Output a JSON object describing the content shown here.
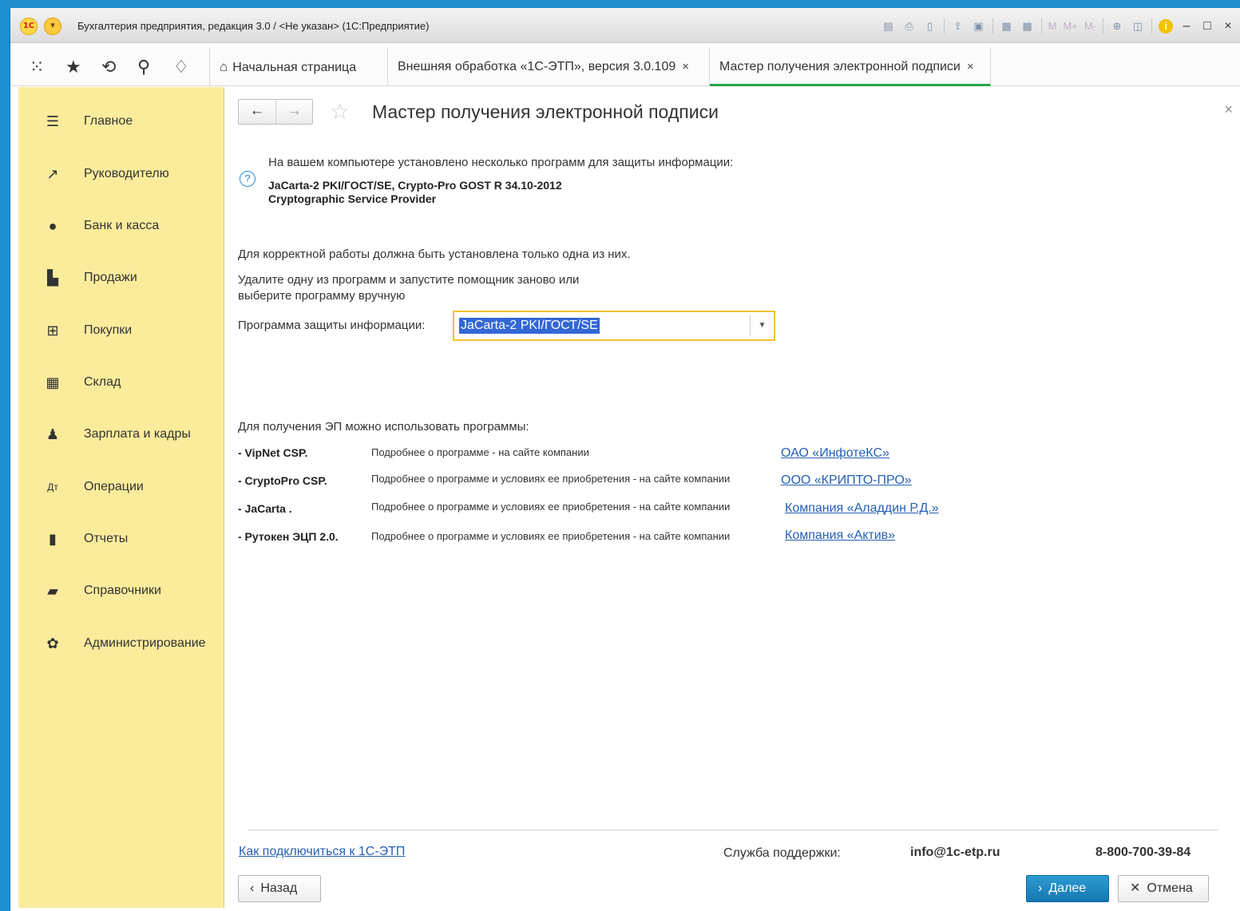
{
  "window": {
    "title": "Бухгалтерия предприятия, редакция 3.0 / <Не указан>  (1С:Предприятие)",
    "logo": "1С",
    "toolbar_icons": [
      "save-icon",
      "print-icon",
      "preview-icon",
      "attach-icon",
      "copy-icon",
      "calculator-icon",
      "calendar-icon"
    ],
    "memory_buttons": [
      "M",
      "M+",
      "M-"
    ]
  },
  "quick_icons": [
    "apps-grid-icon",
    "favorites-star-icon",
    "history-icon",
    "search-icon",
    "notifications-bell-icon"
  ],
  "tabs": [
    {
      "label": "Начальная страница"
    },
    {
      "label": "Внешняя обработка «1С-ЭТП», версия 3.0.109",
      "close": "×"
    },
    {
      "label": "Мастер получения электронной подписи",
      "close": "×"
    }
  ],
  "sidebar": {
    "items": [
      {
        "label": "Главное",
        "icon": "menu-lines-icon"
      },
      {
        "label": "Руководителю",
        "icon": "trend-chart-icon"
      },
      {
        "label": "Банк и касса",
        "icon": "ruble-coin-icon"
      },
      {
        "label": "Продажи",
        "icon": "shopping-bag-icon"
      },
      {
        "label": "Покупки",
        "icon": "cart-icon"
      },
      {
        "label": "Склад",
        "icon": "warehouse-grid-icon"
      },
      {
        "label": "Зарплата и кадры",
        "icon": "person-icon"
      },
      {
        "label": "Операции",
        "icon": "debit-credit-icon"
      },
      {
        "label": "Отчеты",
        "icon": "bar-chart-icon"
      },
      {
        "label": "Справочники",
        "icon": "books-icon"
      },
      {
        "label": "Администрирование",
        "icon": "gear-icon"
      }
    ]
  },
  "main": {
    "title": "Мастер получения электронной подписи",
    "installed_intro": "На вашем компьютере установлено несколько программ для защиты информации:",
    "installed_line1": "JaCarta-2 PKI/ГОСТ/SE, Crypto-Pro GOST R 34.10-2012",
    "installed_line2": "Cryptographic Service Provider",
    "only_one": "Для корректной работы должна быть установлена только одна из них.",
    "remove_line1": "Удалите одну из программ и запустите помощник заново или",
    "remove_line2": "выберите программу вручную",
    "program_label": "Программа защиты информации:",
    "program_value": "JaCarta-2 PKI/ГОСТ/SE",
    "programs_intro": "Для получения ЭП можно использовать программы:",
    "programs": [
      {
        "name": "- VipNet CSP.",
        "desc": "Подробнее о программе - на сайте компании",
        "link": "ОАО «ИнфотеКС»"
      },
      {
        "name": "- CryptoPro CSP.",
        "desc": "Подробнее о программе и условиях ее приобретения - на сайте компании",
        "link": "ООО «КРИПТО-ПРО»"
      },
      {
        "name": "- JaCarta .",
        "desc": "Подробнее о программе и условиях ее приобретения - на сайте компании",
        "link": "Компания «Аладдин Р.Д.»"
      },
      {
        "name": "- Рутокен ЭЦП 2.0.",
        "desc": "Подробнее о программе и условиях ее приобретения - на сайте компании",
        "link": "Компания «Актив»"
      }
    ]
  },
  "footer": {
    "how_to_link": "Как подключиться к 1С-ЭТП",
    "support_label": "Служба поддержки:",
    "support_email": "info@1c-etp.ru",
    "support_phone": "8-800-700-39-84",
    "back": "Назад",
    "next": "Далее",
    "cancel": "Отмена"
  }
}
